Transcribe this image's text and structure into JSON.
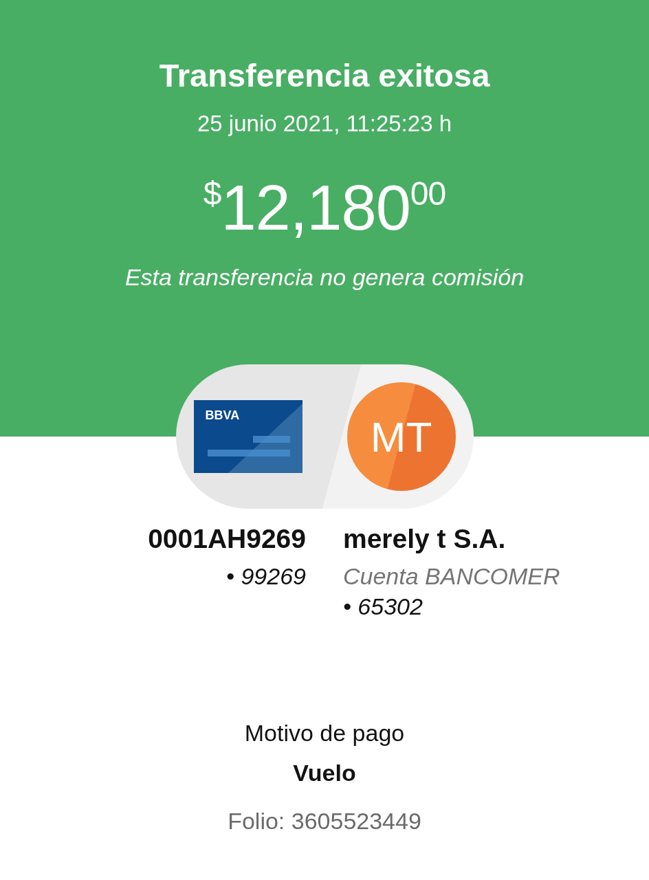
{
  "header": {
    "title": "Transferencia exitosa",
    "date": "25 junio 2021, 11:25:23 h",
    "amount": {
      "currency": "$",
      "whole": "12,180",
      "cents": "00"
    },
    "note": "Esta transferencia no genera comisión"
  },
  "origin": {
    "logo": "BBVA",
    "name": "0001AH9269",
    "account": "• 99269"
  },
  "destination": {
    "initials": "MT",
    "name": "merely t S.A.",
    "bank": "Cuenta BANCOMER",
    "account": "• 65302"
  },
  "details": {
    "label": "Motivo de pago",
    "reason": "Vuelo",
    "folio": "Folio: 3605523449"
  }
}
